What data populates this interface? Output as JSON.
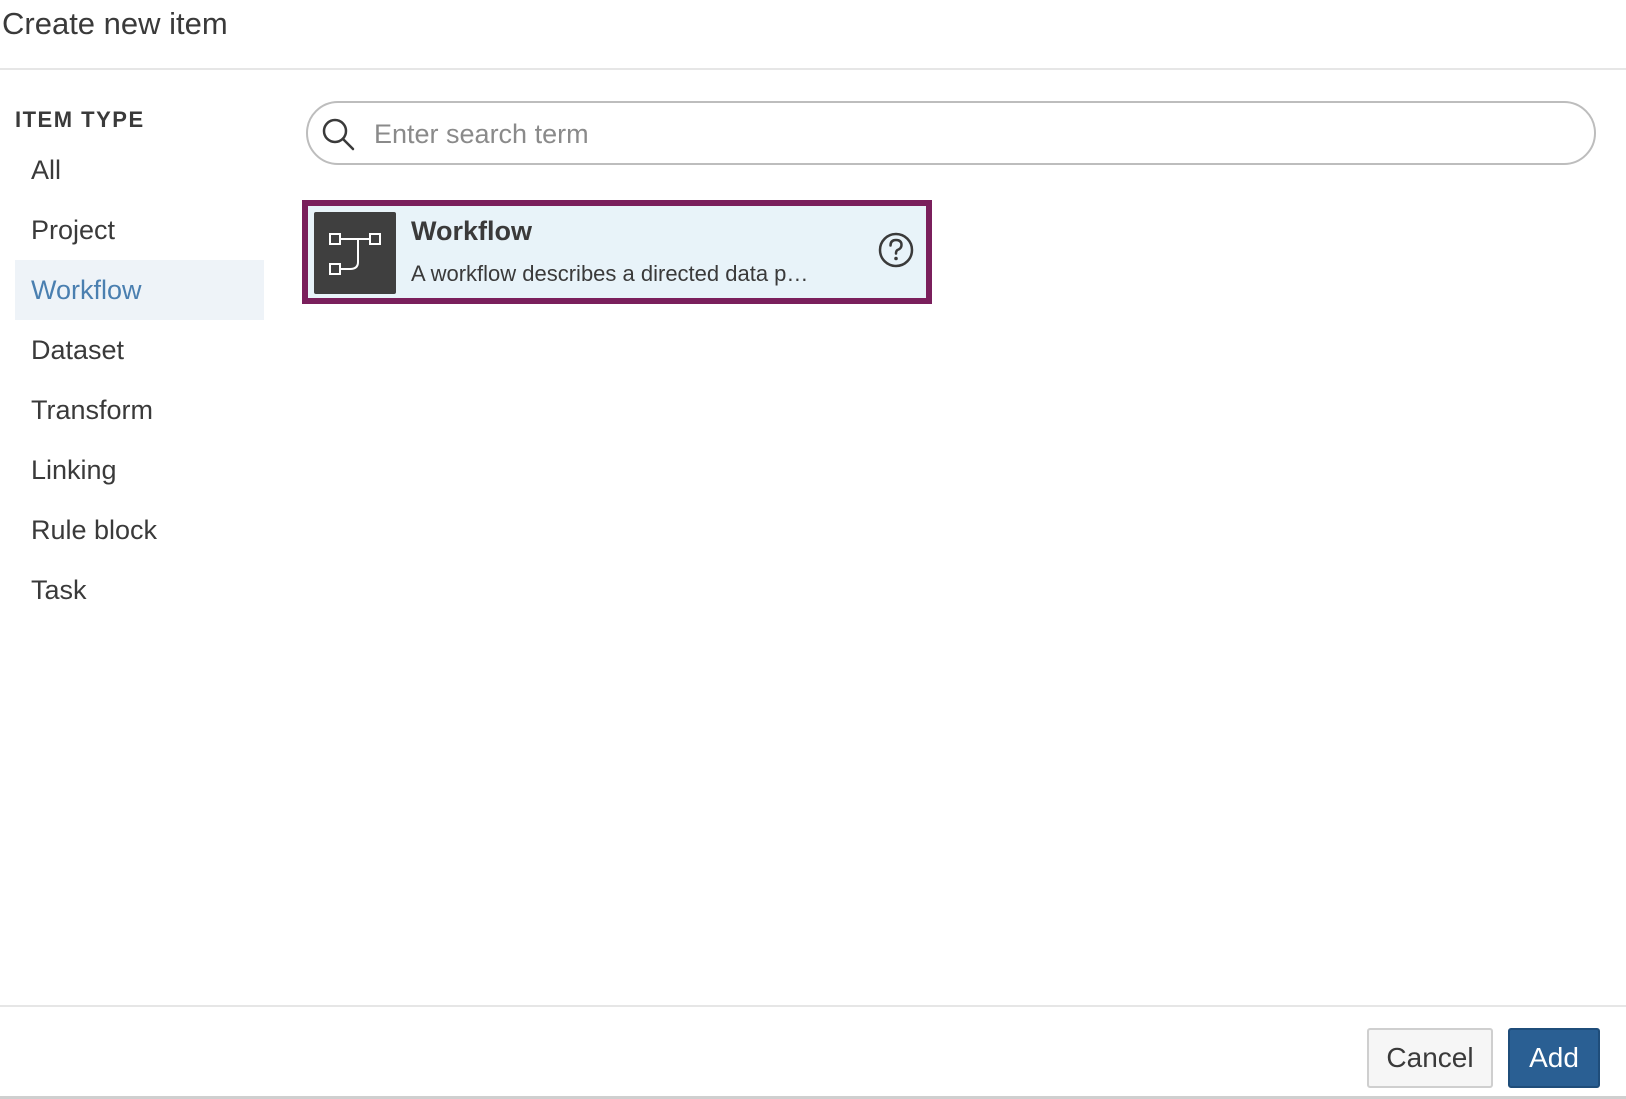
{
  "dialog": {
    "title": "Create new item"
  },
  "sidebar": {
    "heading": "ITEM TYPE",
    "items": [
      {
        "label": "All",
        "active": false
      },
      {
        "label": "Project",
        "active": false
      },
      {
        "label": "Workflow",
        "active": true
      },
      {
        "label": "Dataset",
        "active": false
      },
      {
        "label": "Transform",
        "active": false
      },
      {
        "label": "Linking",
        "active": false
      },
      {
        "label": "Rule block",
        "active": false
      },
      {
        "label": "Task",
        "active": false
      }
    ]
  },
  "search": {
    "placeholder": "Enter search term",
    "value": ""
  },
  "results": [
    {
      "title": "Workflow",
      "description": "A workflow describes a directed data p…",
      "icon": "workflow-icon",
      "selected": true
    }
  ],
  "footer": {
    "cancel_label": "Cancel",
    "add_label": "Add"
  },
  "colors": {
    "accent": "#2a5f93",
    "selection_border": "#7a1f5c",
    "selection_bg": "#e8f3f9",
    "active_item_text": "#4a7fb0"
  }
}
